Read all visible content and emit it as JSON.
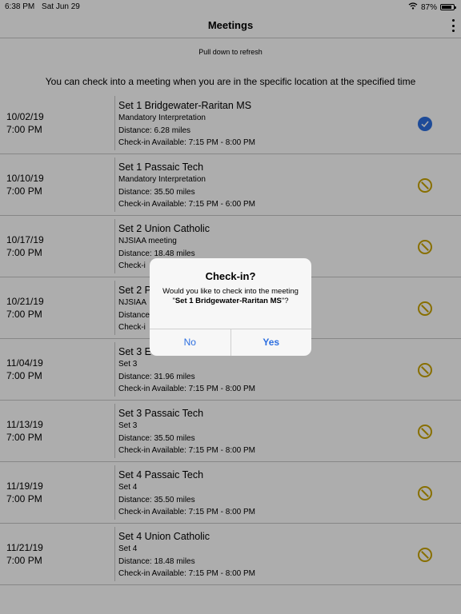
{
  "status_bar": {
    "time": "6:38 PM",
    "date": "Sat Jun 29",
    "battery": "87%",
    "battery_level": 0.87
  },
  "nav": {
    "title": "Meetings"
  },
  "refresh_hint": "Pull down to refresh",
  "info_text": "You can check into a meeting when you are in the specific location at the specified time",
  "meetings": [
    {
      "date": "10/02/19",
      "time": "7:00 PM",
      "name": "Set 1 Bridgewater-Raritan MS",
      "type": "Mandatory Interpretation",
      "distance": "Distance: 6.28 miles",
      "checkin": "Check-in Available: 7:15 PM - 8:00 PM",
      "status": "checked"
    },
    {
      "date": "10/10/19",
      "time": "7:00 PM",
      "name": "Set 1 Passaic Tech",
      "type": "Mandatory Interpretation",
      "distance": "Distance: 35.50 miles",
      "checkin": "Check-in Available: 7:15 PM - 6:00 PM",
      "status": "unavailable"
    },
    {
      "date": "10/17/19",
      "time": "7:00 PM",
      "name": "Set 2 Union Catholic",
      "type": "NJSIAA meeting",
      "distance": "Distance: 18.48 miles",
      "checkin": "Check-i",
      "status": "unavailable"
    },
    {
      "date": "10/21/19",
      "time": "7:00 PM",
      "name": "Set 2 P",
      "type": "NJSIAA",
      "distance": "Distance",
      "checkin": "Check-i",
      "status": "unavailable"
    },
    {
      "date": "11/04/19",
      "time": "7:00 PM",
      "name": "Set 3 E",
      "type": "Set 3",
      "distance": "Distance: 31.96 miles",
      "checkin": "Check-in Available: 7:15 PM - 8:00 PM",
      "status": "unavailable"
    },
    {
      "date": "11/13/19",
      "time": "7:00 PM",
      "name": "Set 3 Passaic Tech",
      "type": "Set 3",
      "distance": "Distance: 35.50 miles",
      "checkin": "Check-in Available: 7:15 PM - 8:00 PM",
      "status": "unavailable"
    },
    {
      "date": "11/19/19",
      "time": "7:00 PM",
      "name": "Set 4 Passaic Tech",
      "type": "Set 4",
      "distance": "Distance: 35.50 miles",
      "checkin": "Check-in Available: 7:15 PM - 8:00 PM",
      "status": "unavailable"
    },
    {
      "date": "11/21/19",
      "time": "7:00 PM",
      "name": "Set 4 Union Catholic",
      "type": "Set 4",
      "distance": "Distance: 18.48 miles",
      "checkin": "Check-in Available: 7:15 PM - 8:00 PM",
      "status": "unavailable"
    }
  ],
  "dialog": {
    "title": "Check-in?",
    "message_prefix": "Would you like to check into the meeting \"",
    "meeting_name": "Set 1 Bridgewater-Raritan MS",
    "message_suffix": "\"?",
    "no_label": "No",
    "yes_label": "Yes"
  },
  "colors": {
    "accent": "#2d6fe0",
    "warning": "#c9a400"
  }
}
